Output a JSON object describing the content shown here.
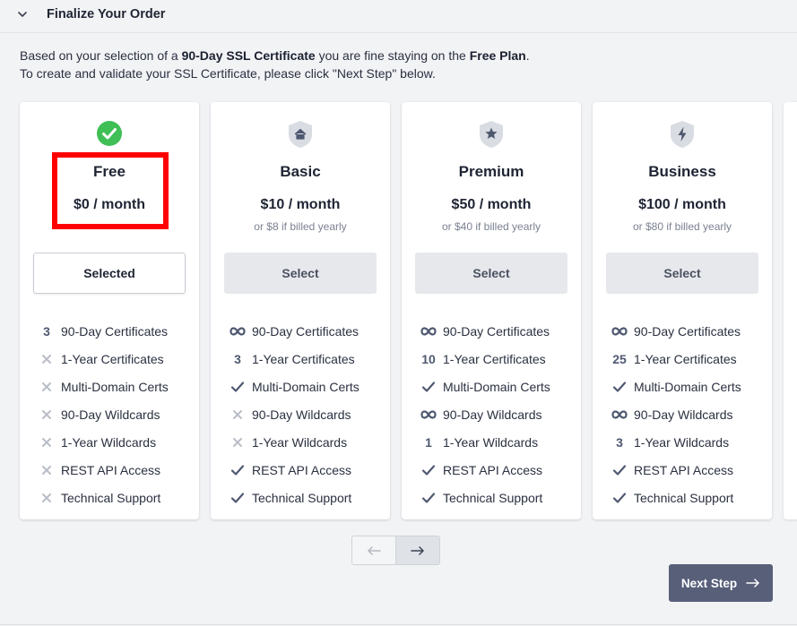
{
  "header": {
    "title": "Finalize Your Order",
    "collapse_icon": "chevron-down-icon"
  },
  "intro": {
    "line1_prefix": "Based on your selection of a ",
    "line1_bold1": "90-Day SSL Certificate",
    "line1_mid": " you are fine staying on the ",
    "line1_bold2": "Free Plan",
    "line1_suffix": ".",
    "line2": "To create and validate your SSL Certificate, please click \"Next Step\" below."
  },
  "colors": {
    "accent": "#575f79",
    "check_green": "#3fbf55",
    "highlight": "#ff0000",
    "select_bg": "#e6e8ec"
  },
  "plans": [
    {
      "icon": "check-circle-icon",
      "name": "Free",
      "price": "$0 / month",
      "yearly": "",
      "button": "Selected",
      "features": [
        {
          "mark": "3",
          "label": "90-Day Certificates"
        },
        {
          "mark": "x",
          "label": "1-Year Certificates"
        },
        {
          "mark": "x",
          "label": "Multi-Domain Certs"
        },
        {
          "mark": "x",
          "label": "90-Day Wildcards"
        },
        {
          "mark": "x",
          "label": "1-Year Wildcards"
        },
        {
          "mark": "x",
          "label": "REST API Access"
        },
        {
          "mark": "x",
          "label": "Technical Support"
        }
      ]
    },
    {
      "icon": "shield-home-icon",
      "name": "Basic",
      "price": "$10 / month",
      "yearly": "or $8 if billed yearly",
      "button": "Select",
      "features": [
        {
          "mark": "infinity",
          "label": "90-Day Certificates"
        },
        {
          "mark": "3",
          "label": "1-Year Certificates"
        },
        {
          "mark": "check",
          "label": "Multi-Domain Certs"
        },
        {
          "mark": "x",
          "label": "90-Day Wildcards"
        },
        {
          "mark": "x",
          "label": "1-Year Wildcards"
        },
        {
          "mark": "check",
          "label": "REST API Access"
        },
        {
          "mark": "check",
          "label": "Technical Support"
        }
      ]
    },
    {
      "icon": "shield-star-icon",
      "name": "Premium",
      "price": "$50 / month",
      "yearly": "or $40 if billed yearly",
      "button": "Select",
      "features": [
        {
          "mark": "infinity",
          "label": "90-Day Certificates"
        },
        {
          "mark": "10",
          "label": "1-Year Certificates"
        },
        {
          "mark": "check",
          "label": "Multi-Domain Certs"
        },
        {
          "mark": "infinity",
          "label": "90-Day Wildcards"
        },
        {
          "mark": "1",
          "label": "1-Year Wildcards"
        },
        {
          "mark": "check",
          "label": "REST API Access"
        },
        {
          "mark": "check",
          "label": "Technical Support"
        }
      ]
    },
    {
      "icon": "shield-bolt-icon",
      "name": "Business",
      "price": "$100 / month",
      "yearly": "or $80 if billed yearly",
      "button": "Select",
      "features": [
        {
          "mark": "infinity",
          "label": "90-Day Certificates"
        },
        {
          "mark": "25",
          "label": "1-Year Certificates"
        },
        {
          "mark": "check",
          "label": "Multi-Domain Certs"
        },
        {
          "mark": "infinity",
          "label": "90-Day Wildcards"
        },
        {
          "mark": "3",
          "label": "1-Year Wildcards"
        },
        {
          "mark": "check",
          "label": "REST API Access"
        },
        {
          "mark": "check",
          "label": "Technical Support"
        }
      ]
    }
  ],
  "pager": {
    "prev_icon": "arrow-left-icon",
    "next_icon": "arrow-right-icon"
  },
  "next_step": {
    "label": "Next Step",
    "icon": "arrow-right-icon"
  }
}
